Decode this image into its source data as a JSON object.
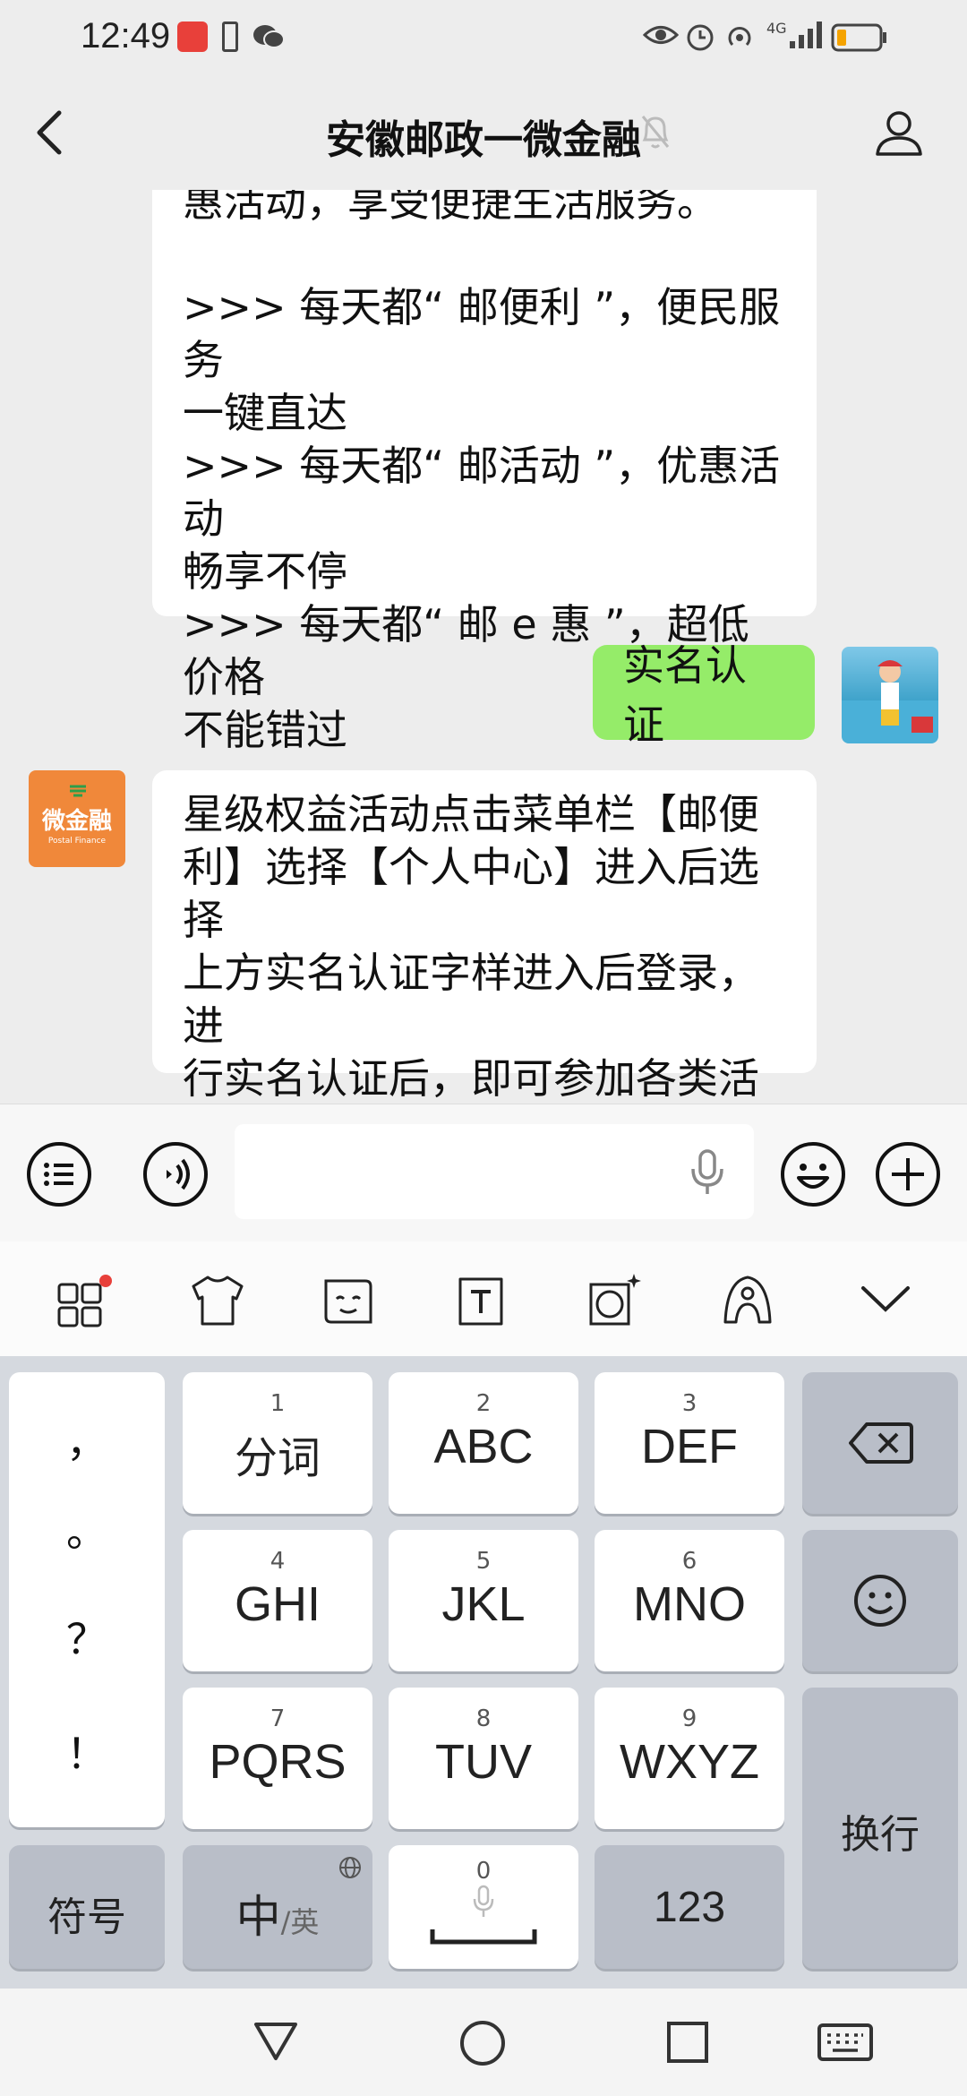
{
  "status_bar": {
    "time": "12:49",
    "network": "4G"
  },
  "header": {
    "title": "安徽邮政一微金融"
  },
  "messages": [
    {
      "from": "official",
      "lines": [
        "惠活动，享受便捷生活服务。",
        "",
        ">>> 每天都“ 邮便利 ”，便民服务",
        "一键直达",
        ">>> 每天都“ 邮活动 ”，优惠活动",
        "畅享不停",
        ">>> 每天都“ 邮 e 惠 ”，超低价格",
        "不能错过"
      ]
    },
    {
      "from": "me",
      "text": "实名认证"
    },
    {
      "from": "official",
      "avatar_text": "微金融",
      "avatar_sub": "Postal Finance",
      "lines": [
        "星级权益活动点击菜单栏【邮便",
        "利】选择【个人中心】进入后选择",
        "上方实名认证字样进入后登录，进",
        "行实名认证后，即可参加各类活动",
        "~"
      ]
    }
  ],
  "keyboard": {
    "punct": [
      "，",
      "。",
      "？",
      "！"
    ],
    "keys": [
      {
        "num": "1",
        "label": "分词"
      },
      {
        "num": "2",
        "label": "ABC"
      },
      {
        "num": "3",
        "label": "DEF"
      },
      {
        "num": "4",
        "label": "GHI"
      },
      {
        "num": "5",
        "label": "JKL"
      },
      {
        "num": "6",
        "label": "MNO"
      },
      {
        "num": "7",
        "label": "PQRS"
      },
      {
        "num": "8",
        "label": "TUV"
      },
      {
        "num": "9",
        "label": "WXYZ"
      }
    ],
    "enter": "换行",
    "symbols": "符号",
    "lang_main": "中",
    "lang_sub": "/英",
    "space_num": "0",
    "numbers": "123"
  },
  "icons": {
    "back": "chevron-left-icon",
    "mute": "bell-off-icon",
    "profile": "person-icon",
    "menu": "list-icon",
    "voice": "voice-icon",
    "mic": "mic-icon",
    "emoji": "emoji-icon",
    "plus": "plus-icon"
  },
  "colors": {
    "accent_green": "#95ec69",
    "logo_orange": "#f0883a",
    "badge_red": "#e8403a"
  }
}
